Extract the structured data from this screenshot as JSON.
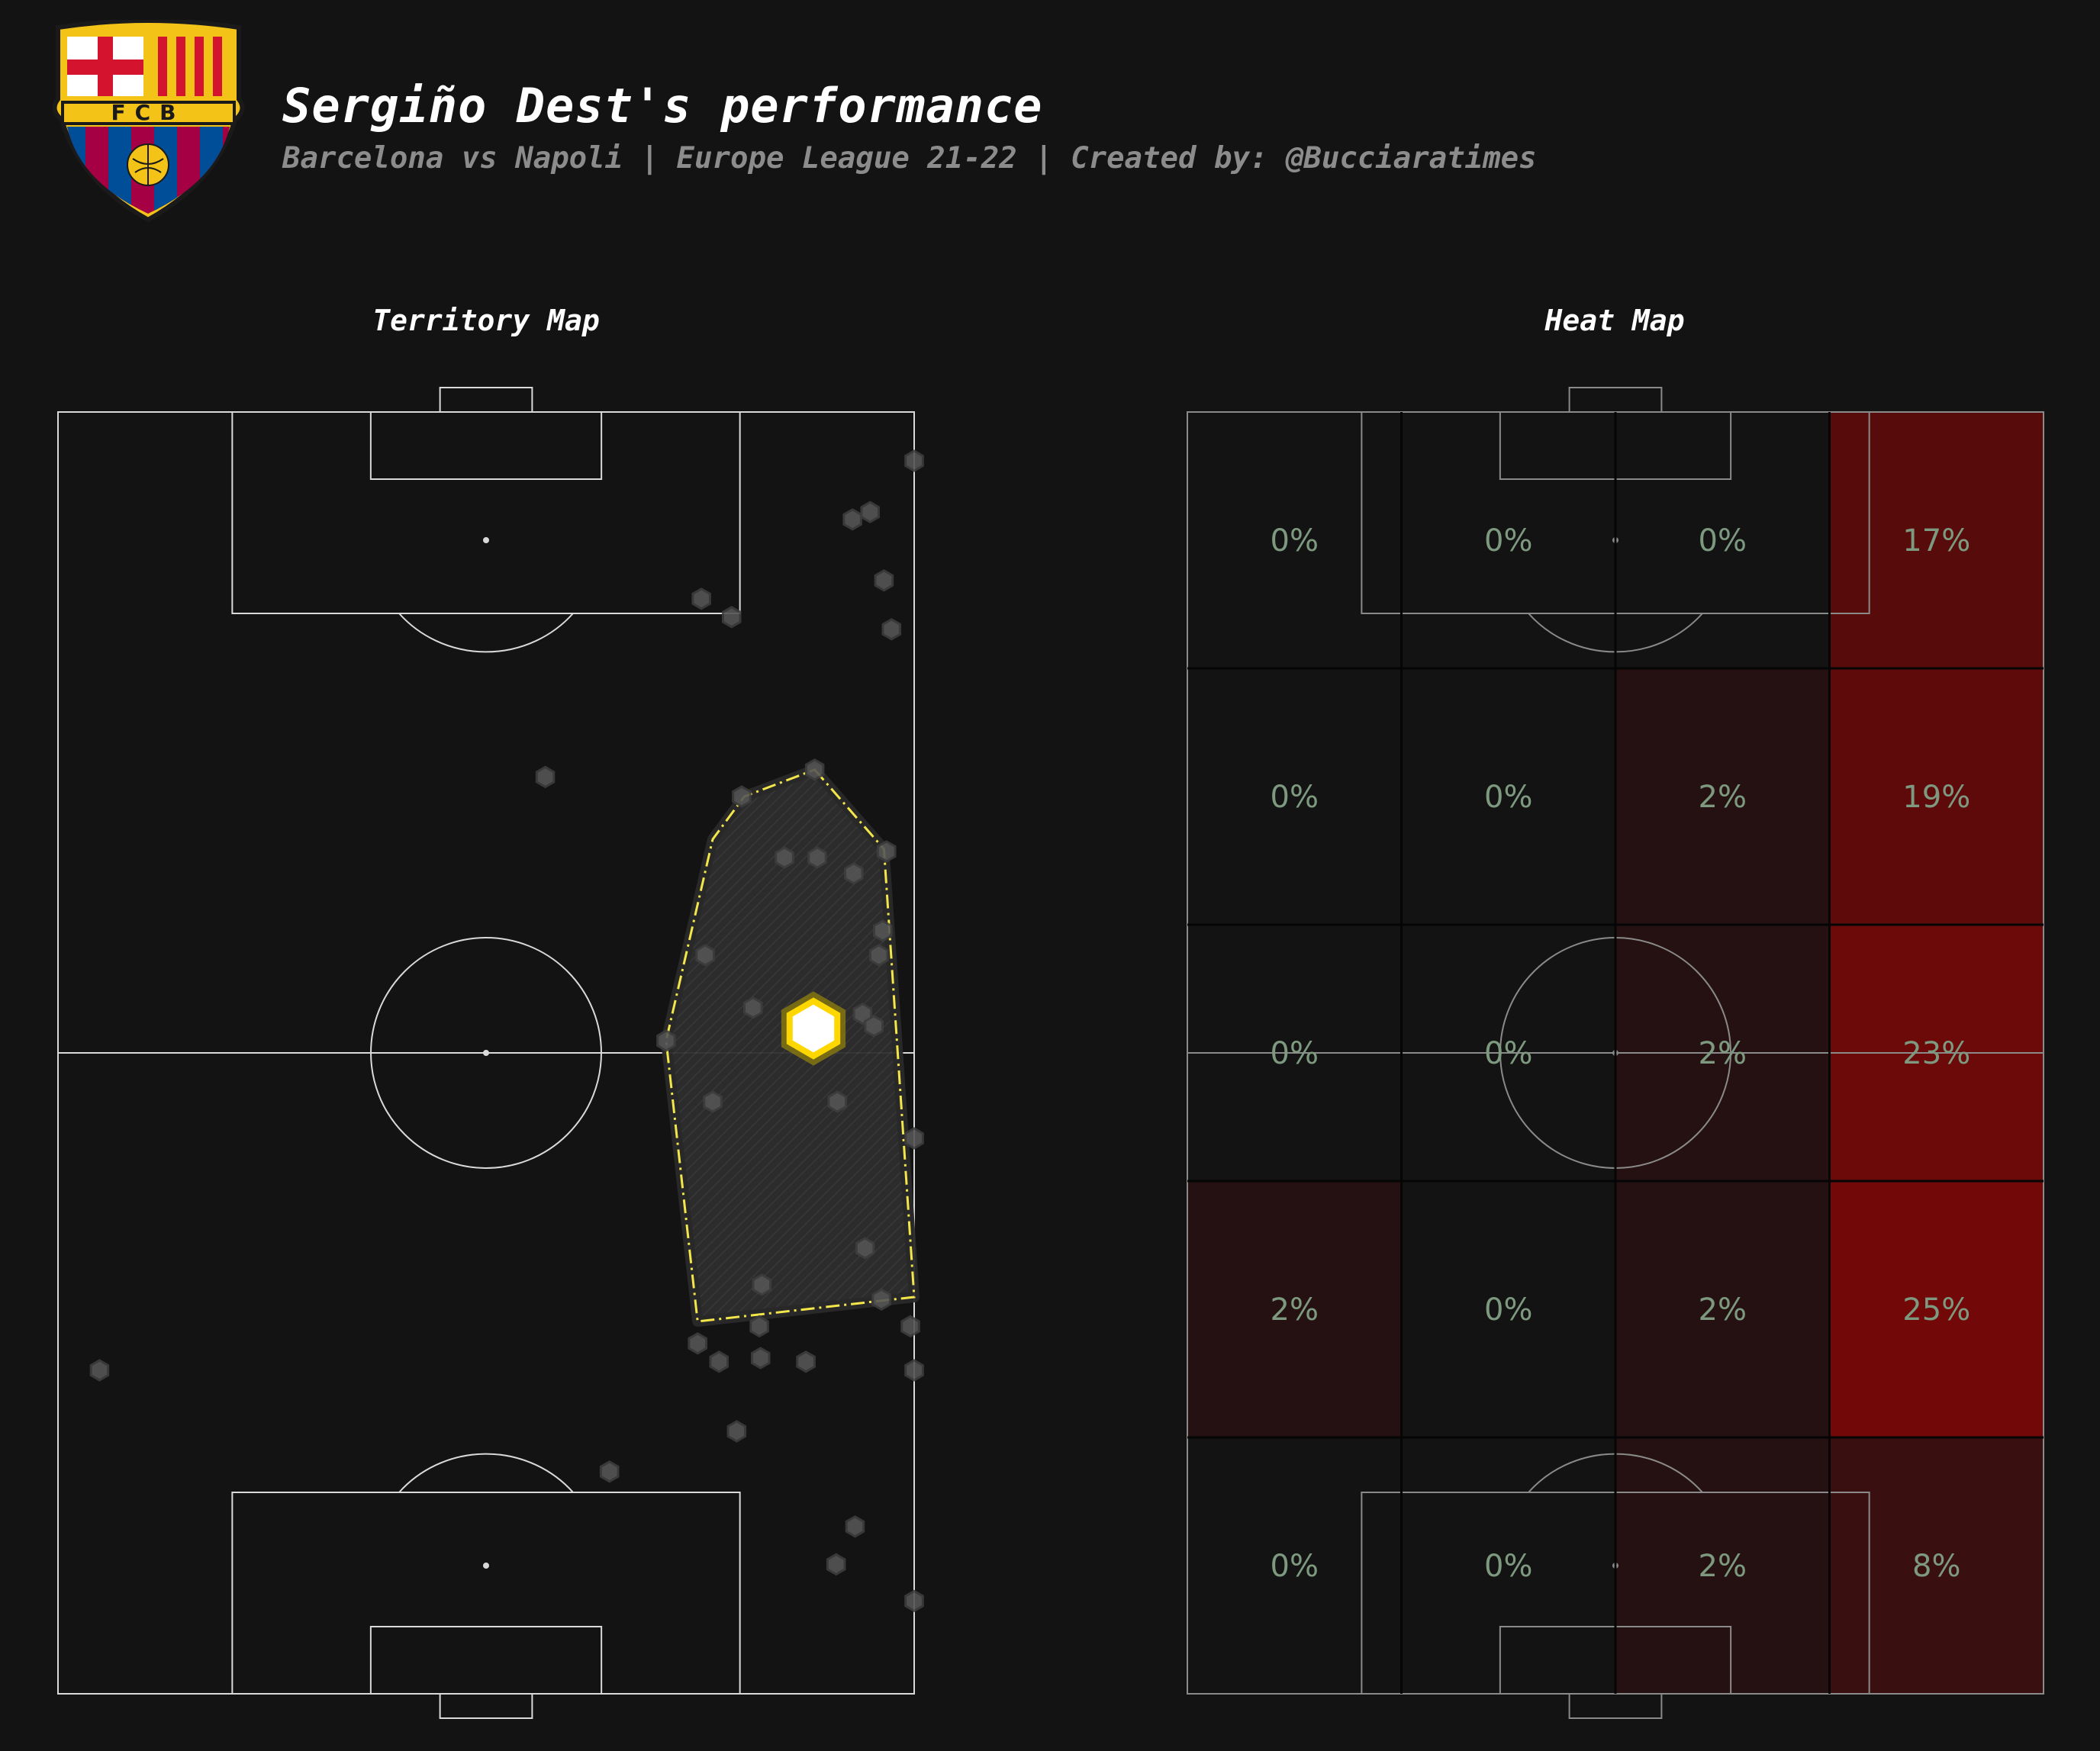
{
  "header": {
    "title": "Sergiño Dest's performance",
    "subtitle": "Barcelona vs Napoli | Europe League 21-22 | Created by: @Bucciaratimes",
    "crest_letters": "FCB"
  },
  "colors": {
    "background": "#131313",
    "lines": "#d9d9d9",
    "hull": "#f2e64b",
    "dots": "#555555",
    "centroid": "#ffd700",
    "heat_high": "#730808",
    "heat_text": "#7d9a80"
  },
  "chart_data": [
    {
      "type": "scatter",
      "title": "Territory Map",
      "xlabel": "",
      "ylabel": "",
      "pitch_units": "width 0-68, length 0-105 (0 = top goal line)",
      "xlim": [
        0,
        68
      ],
      "ylim": [
        0,
        105
      ],
      "points": [
        {
          "x": 68.0,
          "y": 4.0
        },
        {
          "x": 64.5,
          "y": 8.2
        },
        {
          "x": 63.1,
          "y": 8.8
        },
        {
          "x": 65.6,
          "y": 13.8
        },
        {
          "x": 66.2,
          "y": 17.8
        },
        {
          "x": 51.1,
          "y": 15.3
        },
        {
          "x": 53.5,
          "y": 16.8
        },
        {
          "x": 38.7,
          "y": 29.9
        },
        {
          "x": 60.1,
          "y": 29.3
        },
        {
          "x": 54.3,
          "y": 31.5
        },
        {
          "x": 57.7,
          "y": 36.5
        },
        {
          "x": 60.3,
          "y": 36.5
        },
        {
          "x": 63.2,
          "y": 37.8
        },
        {
          "x": 65.8,
          "y": 36.0
        },
        {
          "x": 65.5,
          "y": 42.5
        },
        {
          "x": 65.2,
          "y": 44.5
        },
        {
          "x": 51.4,
          "y": 44.5
        },
        {
          "x": 55.2,
          "y": 48.8
        },
        {
          "x": 63.9,
          "y": 49.3
        },
        {
          "x": 64.8,
          "y": 50.3
        },
        {
          "x": 48.3,
          "y": 51.5
        },
        {
          "x": 52.0,
          "y": 56.5
        },
        {
          "x": 61.9,
          "y": 56.5
        },
        {
          "x": 68.0,
          "y": 59.5
        },
        {
          "x": 64.1,
          "y": 68.5
        },
        {
          "x": 55.9,
          "y": 71.5
        },
        {
          "x": 65.4,
          "y": 72.7
        },
        {
          "x": 55.7,
          "y": 74.9
        },
        {
          "x": 67.7,
          "y": 74.9
        },
        {
          "x": 50.8,
          "y": 76.3
        },
        {
          "x": 52.5,
          "y": 77.8
        },
        {
          "x": 55.8,
          "y": 77.5
        },
        {
          "x": 59.4,
          "y": 77.8
        },
        {
          "x": 68.0,
          "y": 78.5
        },
        {
          "x": 3.3,
          "y": 78.5
        },
        {
          "x": 53.9,
          "y": 83.5
        },
        {
          "x": 43.8,
          "y": 86.8
        },
        {
          "x": 63.3,
          "y": 91.3
        },
        {
          "x": 61.8,
          "y": 94.4
        },
        {
          "x": 68.0,
          "y": 97.4
        }
      ],
      "convex_hull": [
        {
          "x": 60.1,
          "y": 29.3
        },
        {
          "x": 65.6,
          "y": 35.8
        },
        {
          "x": 68.0,
          "y": 72.5
        },
        {
          "x": 50.8,
          "y": 74.5
        },
        {
          "x": 48.3,
          "y": 51.5
        },
        {
          "x": 52.0,
          "y": 35.0
        },
        {
          "x": 54.5,
          "y": 31.5
        }
      ],
      "centroid": {
        "x": 60.0,
        "y": 50.5
      }
    },
    {
      "type": "heatmap",
      "title": "Heat Map",
      "xlabel": "",
      "ylabel": "",
      "columns": 4,
      "rows": 5,
      "values": [
        [
          "0%",
          "0%",
          "0%",
          "17%"
        ],
        [
          "0%",
          "0%",
          "2%",
          "19%"
        ],
        [
          "0%",
          "0%",
          "2%",
          "23%"
        ],
        [
          "2%",
          "0%",
          "2%",
          "25%"
        ],
        [
          "0%",
          "0%",
          "2%",
          "8%"
        ]
      ],
      "numeric": [
        [
          0,
          0,
          0,
          17
        ],
        [
          0,
          0,
          2,
          19
        ],
        [
          0,
          0,
          2,
          23
        ],
        [
          2,
          0,
          2,
          25
        ],
        [
          0,
          0,
          2,
          8
        ]
      ]
    }
  ]
}
